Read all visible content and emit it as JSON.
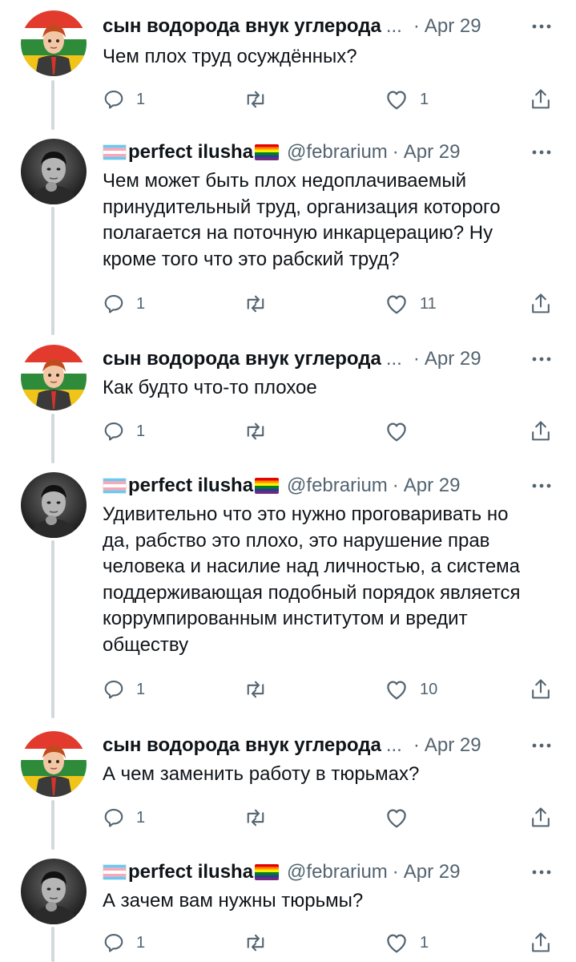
{
  "thread": {
    "tweets": [
      {
        "author_name": "сын водорода внук углерода",
        "name_ellipsis": "...",
        "separator": "·",
        "date": "Apr 29",
        "avatar": "cartoon-avatar-flag-background",
        "body_lines": [
          "Чем плох труд осуждённых?"
        ],
        "reply_count": "1",
        "retweet_count": "",
        "like_count": "1"
      },
      {
        "author_name": "perfect ilusha",
        "handle": "@febrarium",
        "separator": "·",
        "date": "Apr 29",
        "avatar": "bw-photo-child-avatar",
        "body_lines": [
          "Чем может быть плох недоплачиваемый",
          "принудительный труд, организация которого",
          "полагается на поточную инкарцерацию? Ну",
          "кроме того что это рабский труд?"
        ],
        "reply_count": "1",
        "retweet_count": "",
        "like_count": "11"
      },
      {
        "author_name": "сын водорода внук углерода",
        "name_ellipsis": "...",
        "separator": "·",
        "date": "Apr 29",
        "avatar": "cartoon-avatar-flag-background",
        "body_lines": [
          "Как будто что-то плохое"
        ],
        "reply_count": "1",
        "retweet_count": "",
        "like_count": ""
      },
      {
        "author_name": "perfect ilusha",
        "handle": "@febrarium",
        "separator": "·",
        "date": "Apr 29",
        "avatar": "bw-photo-child-avatar",
        "body_lines": [
          "Удивительно что это нужно проговаривать но",
          "да, рабство это плохо, это нарушение прав",
          "человека и насилие над личностью, а система",
          "поддерживающая подобный порядок является",
          "коррумпированным институтом и вредит",
          "обществу"
        ],
        "reply_count": "1",
        "retweet_count": "",
        "like_count": "10"
      },
      {
        "author_name": "сын водорода внук углерода",
        "name_ellipsis": "...",
        "separator": "·",
        "date": "Apr 29",
        "avatar": "cartoon-avatar-flag-background",
        "body_lines": [
          "А чем заменить работу в тюрьмах?"
        ],
        "reply_count": "1",
        "retweet_count": "",
        "like_count": ""
      },
      {
        "author_name": "perfect ilusha",
        "handle": "@febrarium",
        "separator": "·",
        "date": "Apr 29",
        "avatar": "bw-photo-child-avatar",
        "body_lines": [
          "А зачем вам нужны тюрьмы?"
        ],
        "reply_count": "1",
        "retweet_count": "",
        "like_count": "1"
      }
    ]
  },
  "icons": {
    "more": "more-horizontal-icon",
    "reply": "reply-bubble-icon",
    "retweet": "retweet-icon",
    "like": "heart-icon",
    "share": "share-upload-icon",
    "name_emoji_before": "transgender-flag-emoji",
    "name_emoji_after": "rainbow-flag-emoji"
  },
  "colors": {
    "text_primary": "#0f1419",
    "text_secondary": "#536471",
    "thread_line": "#cfd9de"
  }
}
